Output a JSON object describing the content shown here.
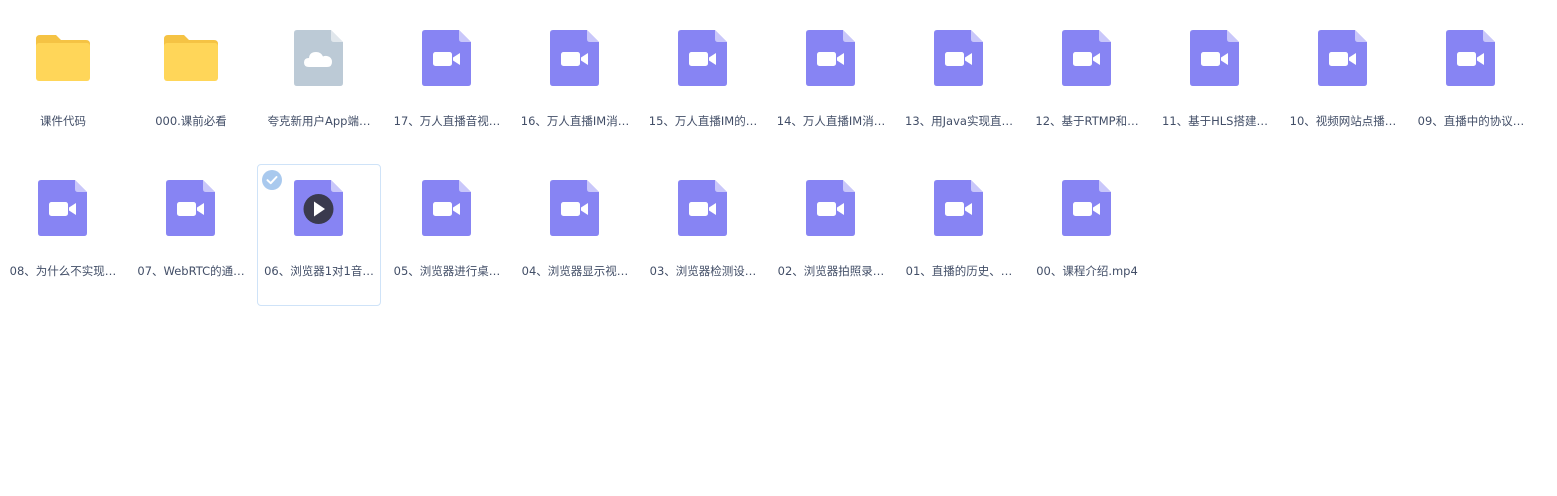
{
  "files": [
    {
      "name": "课件代码",
      "kind": "folder",
      "selected": false
    },
    {
      "name": "000.课前必看",
      "kind": "folder",
      "selected": false
    },
    {
      "name": "夸克新用户App端…",
      "kind": "cloud",
      "selected": false
    },
    {
      "name": "17、万人直播音视…",
      "kind": "video",
      "selected": false
    },
    {
      "name": "16、万人直播IM消…",
      "kind": "video",
      "selected": false
    },
    {
      "name": "15、万人直播IM的…",
      "kind": "video",
      "selected": false
    },
    {
      "name": "14、万人直播IM消…",
      "kind": "video",
      "selected": false
    },
    {
      "name": "13、用Java实现直…",
      "kind": "video",
      "selected": false
    },
    {
      "name": "12、基于RTMP和…",
      "kind": "video",
      "selected": false
    },
    {
      "name": "11、基于HLS搭建…",
      "kind": "video",
      "selected": false
    },
    {
      "name": "10、视频网站点播…",
      "kind": "video",
      "selected": false
    },
    {
      "name": "09、直播中的协议…",
      "kind": "video",
      "selected": false
    },
    {
      "name": "08、为什么不实现…",
      "kind": "video",
      "selected": false
    },
    {
      "name": "07、WebRTC的通…",
      "kind": "video",
      "selected": false
    },
    {
      "name": "06、浏览器1对1音…",
      "kind": "video",
      "selected": true
    },
    {
      "name": "05、浏览器进行桌…",
      "kind": "video",
      "selected": false
    },
    {
      "name": "04、浏览器显示视…",
      "kind": "video",
      "selected": false
    },
    {
      "name": "03、浏览器检测设…",
      "kind": "video",
      "selected": false
    },
    {
      "name": "02、浏览器拍照录…",
      "kind": "video",
      "selected": false
    },
    {
      "name": "01、直播的历史、…",
      "kind": "video",
      "selected": false
    },
    {
      "name": "00、课程介绍.mp4",
      "kind": "video",
      "selected": false
    }
  ],
  "colors": {
    "folder": "#ffd659",
    "folder_tab": "#f5c344",
    "video": "#8784f3",
    "video_fold": "#c9c7fb",
    "cloud_doc": "#bccad6",
    "check": "#a9c9ee",
    "label": "#424e67"
  },
  "icons": {
    "folder": "folder-icon",
    "cloud": "cloud-file-icon",
    "video": "video-file-icon",
    "play": "play-icon",
    "check": "check-circle-icon"
  }
}
